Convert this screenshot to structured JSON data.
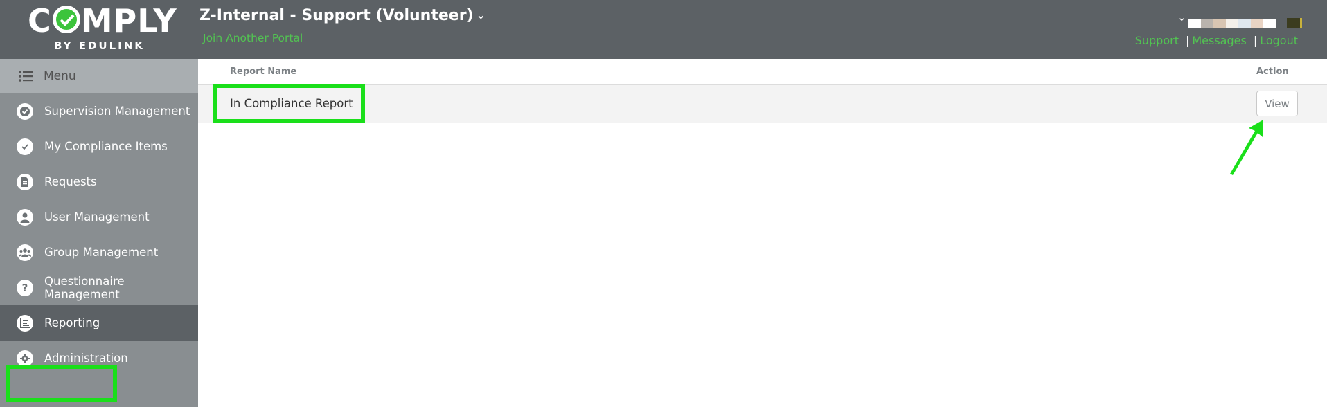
{
  "header": {
    "logo_main_left": "C",
    "logo_main_right": "MPLY",
    "logo_sub": "BY EDULINK",
    "portal_title": "Z-Internal - Support (Volunteer)",
    "portal_chevron": "chevron-down-icon",
    "join_link": "Join Another Portal",
    "links": [
      "Support",
      "Messages",
      "Logout"
    ],
    "separator": "|"
  },
  "sidebar": {
    "menu_label": "Menu",
    "items": [
      {
        "label": "Supervision Management",
        "icon": "check-circle-icon"
      },
      {
        "label": "My Compliance Items",
        "icon": "check-icon"
      },
      {
        "label": "Requests",
        "icon": "document-icon"
      },
      {
        "label": "User Management",
        "icon": "user-icon"
      },
      {
        "label": "Group Management",
        "icon": "group-icon"
      },
      {
        "label": "Questionnaire Management",
        "icon": "question-icon"
      },
      {
        "label": "Reporting",
        "icon": "report-icon",
        "active": true
      },
      {
        "label": "Administration",
        "icon": "gear-icon"
      }
    ]
  },
  "table": {
    "col_name": "Report Name",
    "col_action": "Action",
    "rows": [
      {
        "name": "In Compliance Report",
        "action": "View"
      }
    ]
  },
  "colors": {
    "header_bg": "#5c6165",
    "sidebar_bg": "#898e91",
    "accent_green": "#52c452",
    "highlight_green": "#1adf1a"
  }
}
